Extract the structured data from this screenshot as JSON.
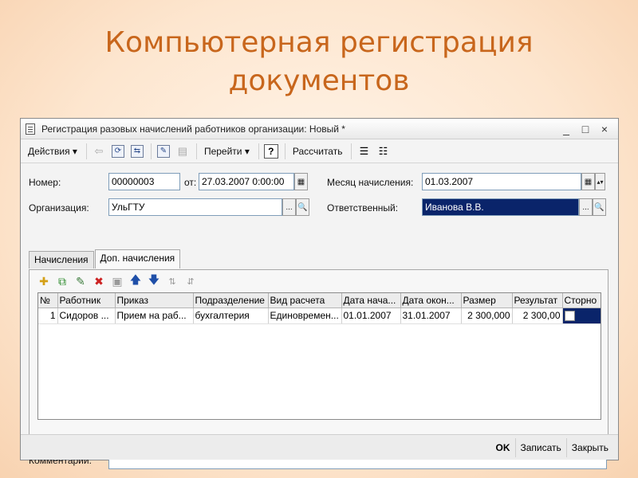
{
  "slide": {
    "title_line1": "Компьютерная регистрация",
    "title_line2": "документов"
  },
  "window": {
    "title": "Регистрация разовых начислений работников организации: Новый *",
    "controls": {
      "minimize": "_",
      "maximize": "□",
      "close": "×"
    }
  },
  "toolbar": {
    "actions_label": "Действия ▾",
    "goto_label": "Перейти ▾",
    "help_label": "?",
    "calculate_label": "Рассчитать"
  },
  "form": {
    "number_label": "Номер:",
    "number_value": "00000003",
    "date_label": "от:",
    "date_value": "27.03.2007  0:00:00",
    "month_label": "Месяц начисления:",
    "month_value": "01.03.2007",
    "org_label": "Организация:",
    "org_value": "УльГТУ",
    "resp_label": "Ответственный:",
    "resp_value": "Иванова В.В.",
    "select_btn": "...",
    "search_btn": "🔍"
  },
  "tabs": [
    {
      "label": "Начисления"
    },
    {
      "label": "Доп. начисления"
    }
  ],
  "table": {
    "headers": [
      "№",
      "Работник",
      "Приказ",
      "Подразделение",
      "Вид расчета",
      "Дата нача...",
      "Дата окон...",
      "Размер",
      "Результат",
      "Сторно"
    ],
    "rows": [
      {
        "n": "1",
        "employee": "Сидоров ...",
        "order": "Прием на раб...",
        "department": "бухгалтерия",
        "calc_type": "Единовремен...",
        "date_start": "01.01.2007",
        "date_end": "31.01.2007",
        "size": "2 300,000",
        "result": "2 300,00"
      }
    ]
  },
  "comment": {
    "label": "Комментарий:",
    "value": ""
  },
  "footer": {
    "ok": "OK",
    "save": "Записать",
    "close": "Закрыть"
  }
}
